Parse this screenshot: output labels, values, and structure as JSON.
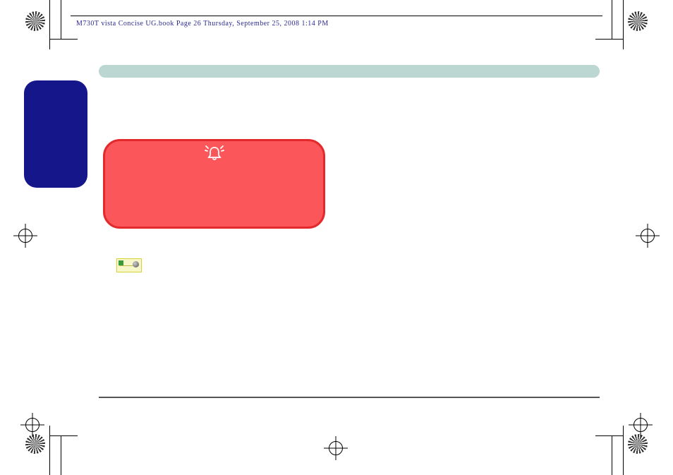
{
  "header": {
    "text": "M730T vista Concise UG.book  Page 26  Thursday, September 25, 2008  1:14 PM"
  },
  "icons": {
    "bell": "bell-alert-icon"
  }
}
